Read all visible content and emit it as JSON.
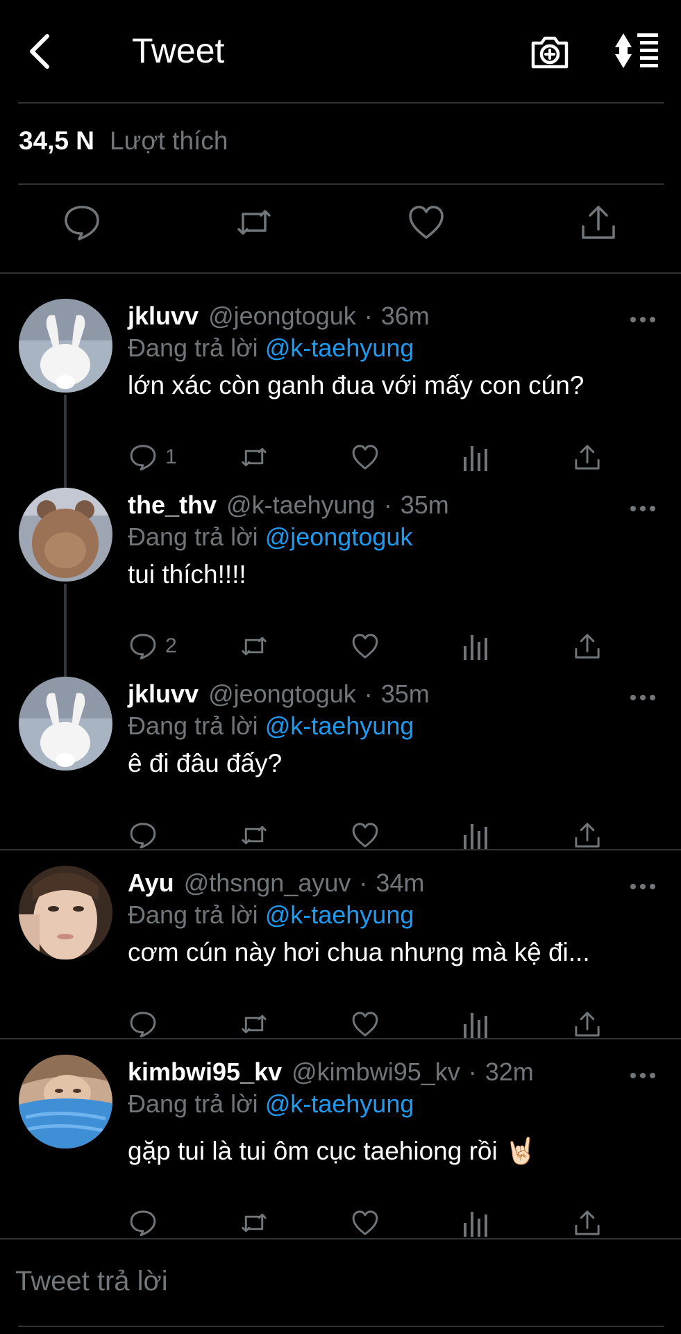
{
  "header": {
    "title": "Tweet"
  },
  "likes": {
    "count": "34,5 N",
    "label": "Lượt thích"
  },
  "replies": [
    {
      "name": "jkluvv",
      "handle": "@jeongtoguk",
      "time": "36m",
      "replying_prefix": "Đang trả lời",
      "replying_to": "@k-taehyung",
      "text": "lớn xác còn ganh đua với mấy con cún?",
      "reply_count": "1"
    },
    {
      "name": "the_thv",
      "handle": "@k-taehyung",
      "time": "35m",
      "replying_prefix": "Đang trả lời",
      "replying_to": "@jeongtoguk",
      "text": "tui thích!!!!",
      "reply_count": "2"
    },
    {
      "name": "jkluvv",
      "handle": "@jeongtoguk",
      "time": "35m",
      "replying_prefix": "Đang trả lời",
      "replying_to": "@k-taehyung",
      "text": "ê đi đâu đấy?",
      "reply_count": ""
    },
    {
      "name": "Ayu",
      "handle": "@thsngn_ayuv",
      "time": "34m",
      "replying_prefix": "Đang trả lời",
      "replying_to": "@k-taehyung",
      "text": "cơm cún này hơi chua nhưng mà kệ đi...",
      "reply_count": ""
    },
    {
      "name": "kimbwi95_kv",
      "handle": "@kimbwi95_kv",
      "time": "32m",
      "replying_prefix": "Đang trả lời",
      "replying_to": "@k-taehyung",
      "text": "gặp tui là tui ôm cục taehiong rồi 🤘🏻",
      "reply_count": ""
    }
  ],
  "composer": {
    "placeholder": "Tweet trả lời"
  },
  "separator": "·",
  "icons": {
    "back": "chevron-left-icon",
    "camera": "camera-plus-icon",
    "sort": "sort-list-icon",
    "reply": "comment-icon",
    "retweet": "retweet-icon",
    "like": "heart-icon",
    "analytics": "bar-chart-icon",
    "share": "share-icon",
    "more": "more-dots-icon"
  },
  "colors": {
    "background": "#000000",
    "text": "#ffffff",
    "muted": "#71767b",
    "accent": "#1d9bf0",
    "divider": "#2f3336"
  }
}
